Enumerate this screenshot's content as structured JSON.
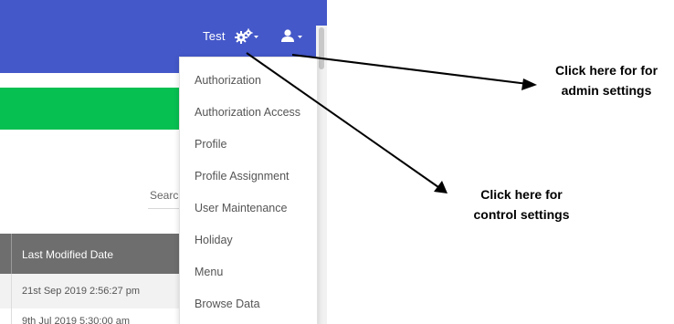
{
  "header": {
    "user_name": "Test"
  },
  "search": {
    "label": "Searcl"
  },
  "table": {
    "header_label": "Last Modified Date",
    "rows": [
      "21st Sep 2019 2:56:27 pm",
      "9th Jul 2019 5:30:00 am"
    ]
  },
  "dropdown_menu": {
    "items": [
      "Authorization",
      "Authorization Access",
      "Profile",
      "Profile Assignment",
      "User Maintenance",
      "Holiday",
      "Menu",
      "Browse Data"
    ]
  },
  "annotations": {
    "admin_line1": "Click here for for",
    "admin_line2": "admin settings",
    "control_line1": "Click here for",
    "control_line2": "control settings"
  },
  "icons": {
    "settings": "gears-icon",
    "user": "user-icon",
    "dropdown": "caret-down-icon"
  },
  "colors": {
    "navbar": "#4458c9",
    "banner": "#06c052",
    "table_header": "#6e6e6e",
    "annotation": "#000000"
  }
}
